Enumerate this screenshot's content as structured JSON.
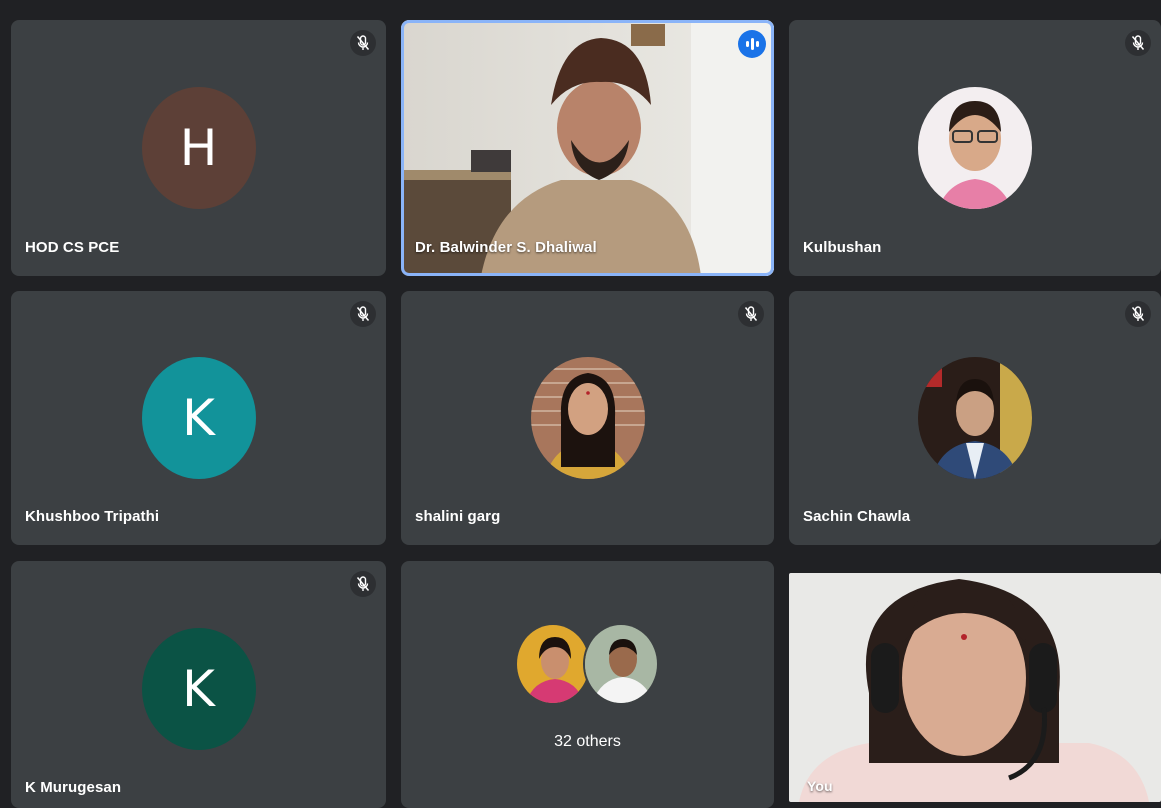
{
  "meeting": {
    "participants": [
      {
        "name": "HOD CS PCE",
        "initial": "H",
        "avatar_color": "#5d4037",
        "muted": true
      },
      {
        "name": "Dr. Balwinder S. Dhaliwal",
        "speaking": true,
        "muted": false
      },
      {
        "name": "Kulbushan",
        "muted": true
      },
      {
        "name": "Khushboo Tripathi",
        "initial": "K",
        "avatar_color": "#12939a",
        "muted": true
      },
      {
        "name": "shalini garg",
        "muted": true
      },
      {
        "name": "Sachin Chawla",
        "muted": true
      },
      {
        "name": "K Murugesan",
        "initial": "K",
        "avatar_color": "#0b5345",
        "muted": true
      }
    ],
    "others": {
      "label": "32 others"
    },
    "self": {
      "label": "You"
    }
  },
  "colors": {
    "tile_bg": "#3c4043",
    "speaking_border": "#8ab4f8",
    "speaking_badge": "#1a73e8"
  },
  "icons": {
    "mute": "mic-off-icon",
    "speaking": "audio-wave-icon"
  }
}
